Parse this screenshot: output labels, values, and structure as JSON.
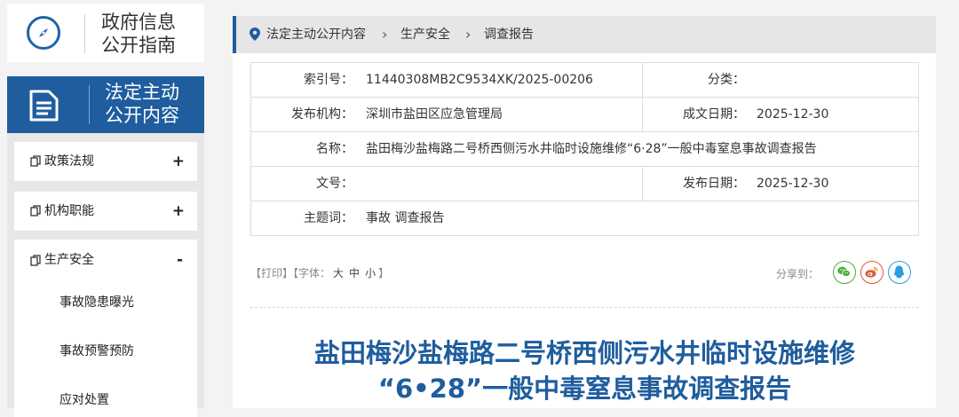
{
  "guide": {
    "title": "政府信息公开指南",
    "line1": "政府信息",
    "line2": "公开指南"
  },
  "section": {
    "line1": "法定主动",
    "line2": "公开内容"
  },
  "sidebar": {
    "items": [
      {
        "label": "政策法规",
        "toggle": "+"
      },
      {
        "label": "机构职能",
        "toggle": "+"
      }
    ],
    "open_item": {
      "label": "生产安全",
      "toggle": "-",
      "children": [
        "事故隐患曝光",
        "事故预警预防",
        "应对处置"
      ]
    }
  },
  "breadcrumb": [
    "法定主动公开内容",
    "生产安全",
    "调查报告"
  ],
  "info": {
    "index_label": "索引号：",
    "index_value": "11440308MB2C9534XK/2025-00206",
    "category_label": "分类：",
    "category_value": "",
    "publisher_label": "发布机构：",
    "publisher_value": "深圳市盐田区应急管理局",
    "written_label": "成文日期：",
    "written_value": "2025-12-30",
    "name_label": "名称：",
    "name_value": "盐田梅沙盐梅路二号桥西侧污水井临时设施维修“6·28”一般中毒窒息事故调查报告",
    "docno_label": "文号：",
    "docno_value": "",
    "pubdate_label": "发布日期：",
    "pubdate_value": "2025-12-30",
    "keywords_label": "主题词：",
    "keywords_value": "事故 调查报告"
  },
  "tools": {
    "print": "【打印】",
    "font_open": "【字体：",
    "large": "大",
    "medium": "中",
    "small": "小",
    "font_close": "】",
    "share_label": "分享到：",
    "share_icons": [
      "wechat-icon",
      "weibo-icon",
      "qq-icon"
    ]
  },
  "article": {
    "title_line1": "盐田梅沙盐梅路二号桥西侧污水井临时设施维修",
    "title_line2": "“6•28”一般中毒窒息事故调查报告"
  },
  "colors": {
    "brand_blue": "#1f5d9e",
    "wechat": "#4caf3b",
    "weibo": "#e2573b",
    "qq": "#2d9be4"
  }
}
